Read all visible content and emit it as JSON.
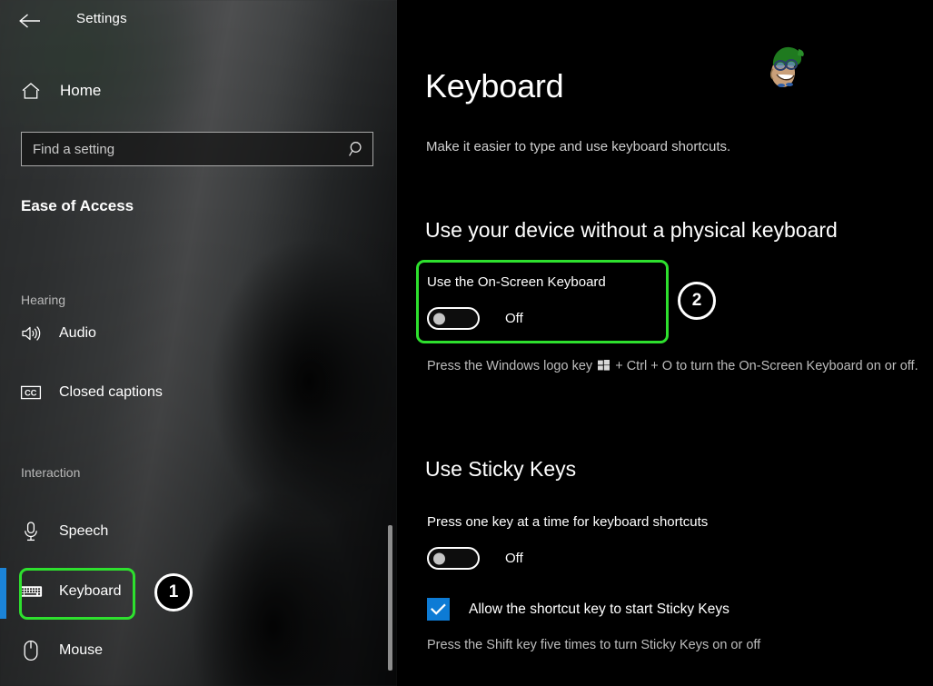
{
  "window": {
    "title": "Settings",
    "back_icon": "back-arrow-icon"
  },
  "sidebar": {
    "home": {
      "label": "Home",
      "icon": "home-icon"
    },
    "search": {
      "value": "",
      "placeholder": "Find a setting",
      "icon": "search-icon"
    },
    "category_heading": "Ease of Access",
    "groups": [
      {
        "label": "Hearing",
        "items": [
          {
            "label": "Audio",
            "icon": "audio-speaker-icon",
            "selected": false
          },
          {
            "label": "Closed captions",
            "icon": "closed-captions-icon",
            "selected": false
          }
        ]
      },
      {
        "label": "Interaction",
        "items": [
          {
            "label": "Speech",
            "icon": "microphone-icon",
            "selected": false
          },
          {
            "label": "Keyboard",
            "icon": "keyboard-icon",
            "selected": true
          },
          {
            "label": "Mouse",
            "icon": "mouse-icon",
            "selected": false
          }
        ]
      }
    ]
  },
  "main": {
    "title": "Keyboard",
    "subtitle": "Make it easier to type and use keyboard shortcuts.",
    "avatar_icon": "cartoon-avatar-green-beret",
    "sections": [
      {
        "heading": "Use your device without a physical keyboard",
        "setting_label": "Use the On-Screen Keyboard",
        "toggle_state": "Off",
        "helper_pre": "Press the Windows logo key ",
        "helper_post": " + Ctrl + O to turn the On-Screen Keyboard on or off."
      },
      {
        "heading": "Use Sticky Keys",
        "setting_label": "Press one key at a time for keyboard shortcuts",
        "toggle_state": "Off",
        "checkbox_label": "Allow the shortcut key to start Sticky Keys",
        "checkbox_checked": true,
        "helper": "Press the Shift key five times to turn Sticky Keys on or off"
      }
    ]
  },
  "annotations": {
    "callout_one": "1",
    "callout_two": "2",
    "box_color": "#2EE02E",
    "circle_fill": "#000000",
    "circle_ring": "#FFFFFF"
  },
  "colors": {
    "accent_blue": "#0D7BD5",
    "selection_bar": "#1B84D8",
    "main_background": "#000000",
    "text_primary": "#FFFFFF",
    "text_secondary": "#BDBDBD"
  }
}
